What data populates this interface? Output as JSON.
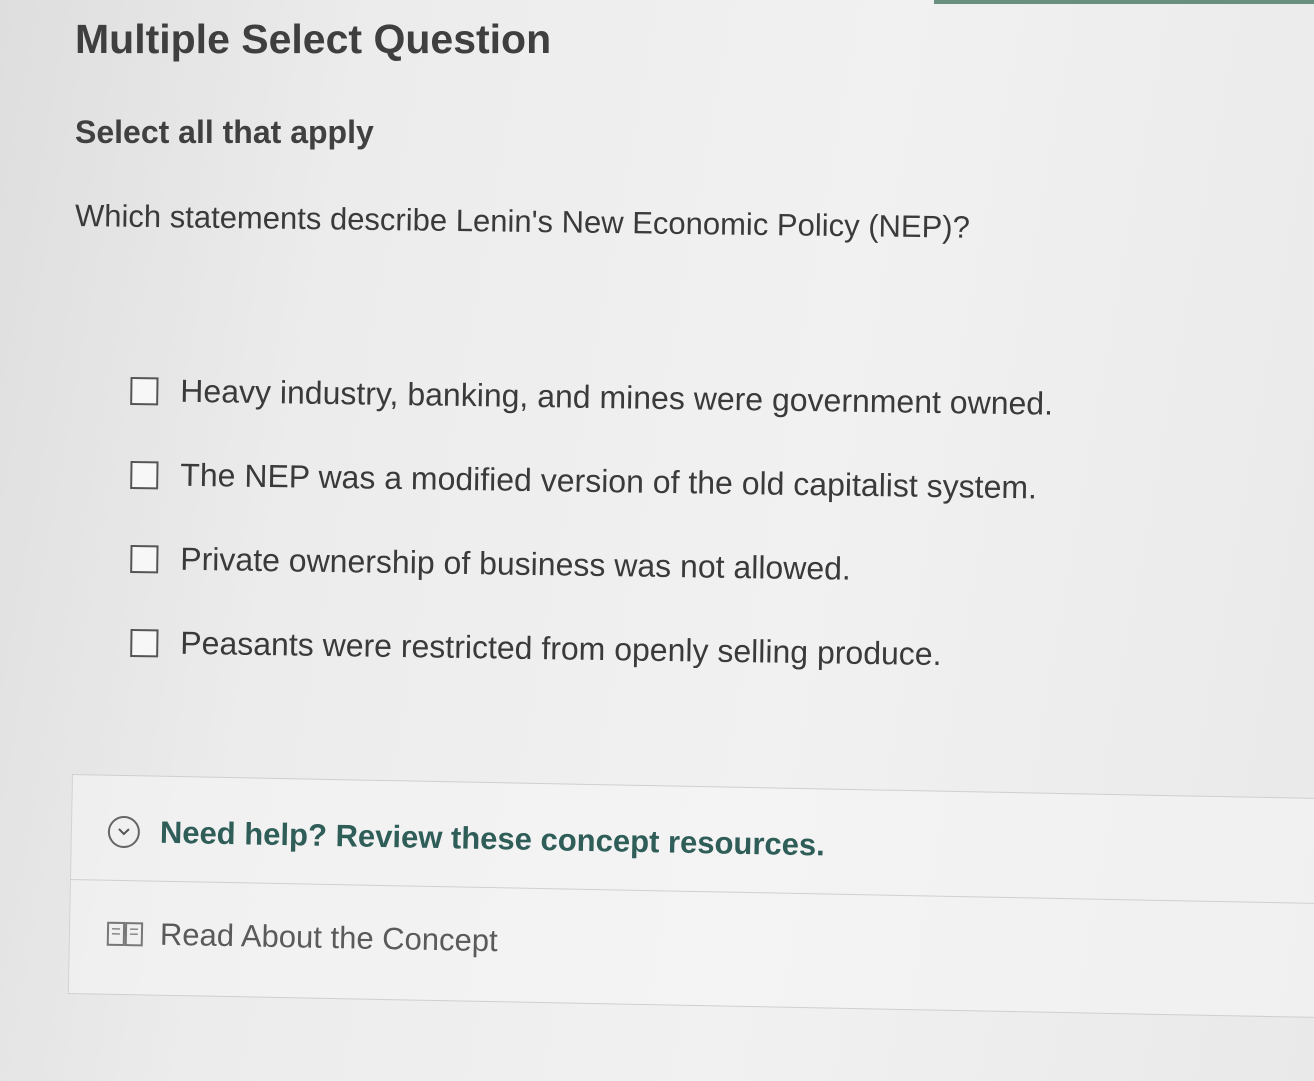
{
  "question": {
    "type_heading": "Multiple Select Question",
    "instruction": "Select all that apply",
    "prompt": "Which statements describe Lenin's New Economic Policy (NEP)?"
  },
  "options": [
    {
      "label": "Heavy industry, banking, and mines were government owned.",
      "checked": false
    },
    {
      "label": "The NEP was a modified version of the old capitalist system.",
      "checked": false
    },
    {
      "label": "Private ownership of business was not allowed.",
      "checked": false
    },
    {
      "label": "Peasants were restricted from openly selling produce.",
      "checked": false
    }
  ],
  "help": {
    "toggle_label": "Need help? Review these concept resources.",
    "toggle_icon": "chevron-down-circle-icon",
    "resources": [
      {
        "label": "Read About the Concept",
        "icon": "book-icon"
      }
    ]
  },
  "colors": {
    "help_text": "#2f5d58",
    "accent": "#6b8f7f"
  }
}
